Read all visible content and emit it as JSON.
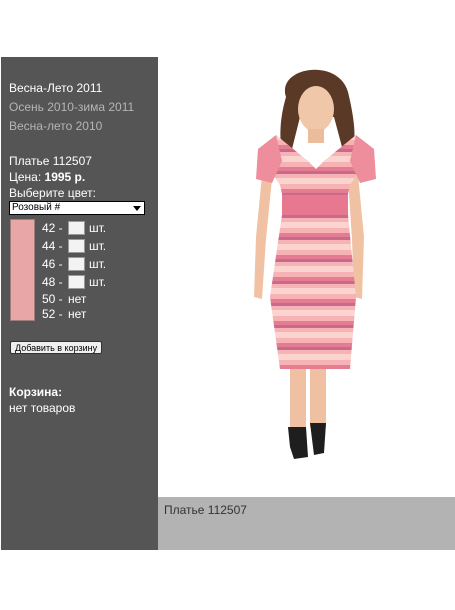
{
  "nav": {
    "seasons": [
      {
        "label": "Весна-Лето 2011",
        "active": true
      },
      {
        "label": "Осень 2010-зима 2011",
        "active": false
      },
      {
        "label": "Весна-лето 2010",
        "active": false
      }
    ]
  },
  "product": {
    "title": "Платье 112507",
    "price_label": "Цена:",
    "price_value": "1995 р.",
    "choose_color_label": "Выберите цвет:",
    "color_selected": "Розовый #",
    "swatch_color": "#e8a6a7",
    "sizes": [
      {
        "size": "42 -",
        "status": "шт.",
        "available": true
      },
      {
        "size": "44 -",
        "status": "шт.",
        "available": true
      },
      {
        "size": "46 -",
        "status": "шт.",
        "available": true
      },
      {
        "size": "48 -",
        "status": "шт.",
        "available": true
      },
      {
        "size": "50 -",
        "status": "нет",
        "available": false
      },
      {
        "size": "52 -",
        "status": "нет",
        "available": false
      }
    ],
    "add_to_cart_label": "Добавить в корзину"
  },
  "cart": {
    "heading": "Корзина:",
    "status": "нет товаров"
  },
  "photo": {
    "caption": "Платье 112507"
  },
  "colors": {
    "sidebar_bg": "#555555",
    "caption_bg": "#b3b3b3",
    "dress_pink": "#f08a96"
  }
}
